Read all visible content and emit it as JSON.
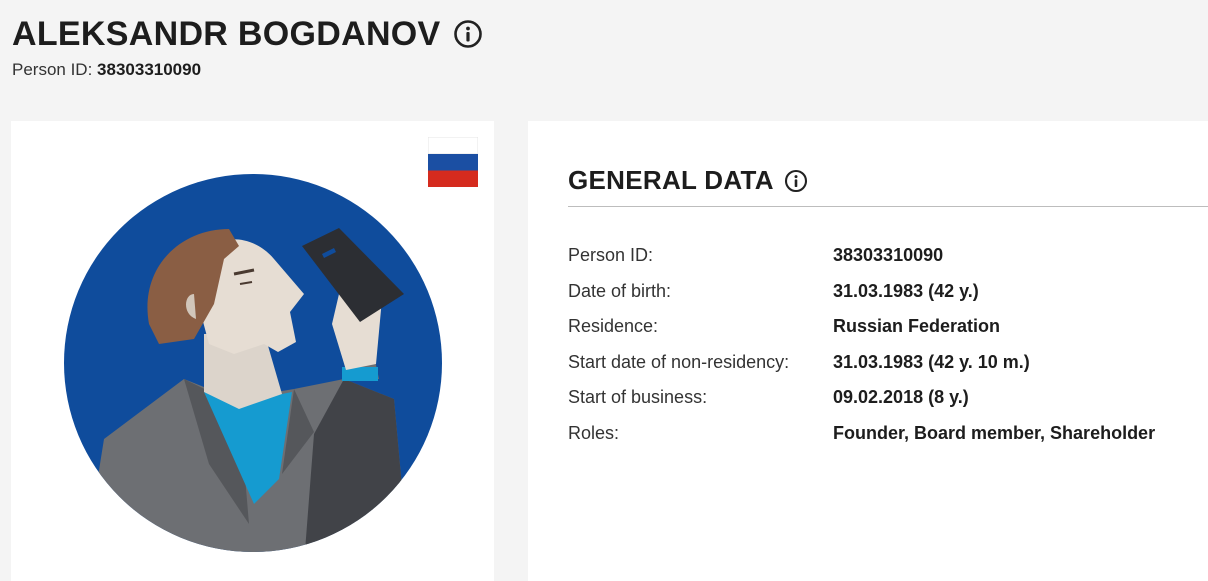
{
  "header": {
    "name": "ALEKSANDR BOGDANOV",
    "person_id_label": "Person ID:",
    "person_id_value": "38303310090"
  },
  "profile": {
    "flag": "russian-flag",
    "avatar": "person-with-phone-illustration"
  },
  "general": {
    "title": "GENERAL DATA",
    "rows": [
      {
        "label": "Person ID:",
        "value": "38303310090"
      },
      {
        "label": "Date of birth:",
        "value": "31.03.1983 (42 y.)"
      },
      {
        "label": "Residence:",
        "value": "Russian Federation"
      },
      {
        "label": "Start date of non-residency:",
        "value": "31.03.1983 (42 y. 10 m.)"
      },
      {
        "label": "Start of business:",
        "value": "09.02.2018 (8 y.)"
      },
      {
        "label": "Roles:",
        "value": "Founder, Board member, Shareholder"
      }
    ]
  },
  "colors": {
    "background": "#f4f4f4",
    "card": "#ffffff",
    "avatar_circle": "#0f4c9c",
    "flag_white": "#ffffff",
    "flag_blue": "#1b4fa3",
    "flag_red": "#d52b1e"
  }
}
